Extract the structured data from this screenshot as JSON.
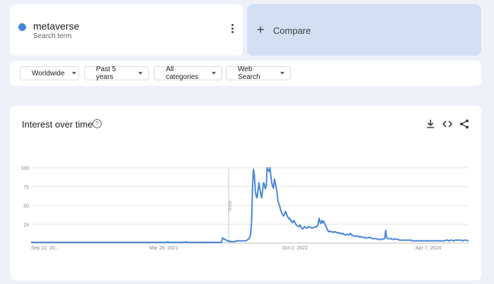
{
  "search_term": {
    "name": "metaverse",
    "subtitle": "Search term",
    "color": "#4a86d8"
  },
  "compare": {
    "label": "Compare"
  },
  "filters": [
    {
      "label": "Worldwide"
    },
    {
      "label": "Past 5 years"
    },
    {
      "label": "All categories"
    },
    {
      "label": "Web Search"
    }
  ],
  "chart_card": {
    "title": "Interest over time",
    "icons": [
      "download-icon",
      "embed-icon",
      "share-icon"
    ]
  },
  "chart_data": {
    "type": "line",
    "title": "Interest over time",
    "xlabel": "",
    "ylabel": "",
    "x_tick_labels": [
      "Sep 22, 20...",
      "Mar 28, 2021",
      "Oct 2, 2022",
      "Apr 7, 2024"
    ],
    "y_ticks": [
      25,
      50,
      75,
      100
    ],
    "ylim": [
      0,
      100
    ],
    "grid": true,
    "annotation": "Note",
    "series": [
      {
        "color": "#4a86d8",
        "values": [
          1,
          1,
          1,
          1,
          1,
          1,
          1,
          1,
          1,
          1,
          1,
          1,
          1,
          1,
          1,
          1,
          1,
          1,
          1,
          1,
          1,
          1,
          1,
          1,
          1,
          1,
          1,
          1,
          1,
          1,
          1,
          1,
          1,
          1,
          1,
          1,
          1,
          1,
          1,
          1,
          1,
          1,
          1,
          1,
          1,
          1,
          1,
          1,
          1,
          1,
          1,
          1,
          1,
          1,
          1,
          1,
          1,
          1,
          1,
          1,
          1,
          1,
          1,
          1,
          1,
          1,
          1,
          1,
          1,
          1,
          1,
          1,
          1,
          1,
          1,
          1,
          1,
          1,
          1,
          1,
          1,
          1,
          1,
          1,
          1,
          1,
          1,
          1,
          1,
          1,
          1,
          1,
          1,
          1,
          1,
          1,
          1,
          1,
          1,
          1,
          1,
          1,
          1,
          1,
          1,
          1,
          1,
          1,
          1,
          1,
          1,
          1,
          1,
          1,
          1,
          1,
          1,
          1,
          1,
          1,
          1,
          1,
          1,
          1,
          1,
          1,
          1,
          1,
          1,
          1,
          1,
          1,
          1,
          1,
          1,
          1,
          1,
          1,
          1,
          1,
          1,
          1,
          1,
          1,
          1,
          1,
          1,
          1,
          1,
          1,
          2,
          1,
          1,
          1,
          1,
          1,
          1,
          1,
          1,
          1,
          1,
          1,
          1,
          1,
          1,
          1,
          1,
          1,
          1,
          1,
          2,
          1,
          1,
          1,
          1,
          1,
          1,
          1,
          1,
          1,
          1,
          1,
          1,
          1,
          1,
          1,
          1,
          1,
          1,
          1,
          1,
          1,
          1,
          1,
          1,
          1,
          1,
          1,
          1,
          1,
          1,
          1,
          1,
          1,
          1,
          1,
          1,
          1,
          1,
          1,
          7,
          6,
          5,
          5,
          4,
          3,
          3,
          2,
          3,
          2,
          2,
          2,
          2,
          2,
          2,
          3,
          3,
          3,
          3,
          3,
          3,
          3,
          3,
          3,
          3,
          3,
          3,
          4,
          5,
          6,
          8,
          13,
          30,
          75,
          98,
          90,
          70,
          62,
          60,
          70,
          80,
          72,
          65,
          60,
          70,
          80,
          78,
          72,
          75,
          100,
          97,
          95,
          100,
          90,
          80,
          75,
          73,
          85,
          80,
          73,
          65,
          55,
          52,
          48,
          43,
          40,
          38,
          36,
          38,
          42,
          40,
          36,
          34,
          32,
          33,
          30,
          28,
          27,
          30,
          29,
          26,
          24,
          23,
          22,
          22,
          24,
          22,
          20,
          19,
          20,
          22,
          21,
          20,
          20,
          22,
          21,
          21,
          21,
          20,
          20,
          21,
          21,
          22,
          21,
          23,
          25,
          33,
          28,
          26,
          30,
          27,
          29,
          26,
          24,
          21,
          18,
          16,
          15,
          16,
          15,
          15,
          15,
          14,
          15,
          15,
          14,
          14,
          13,
          14,
          13,
          13,
          12,
          13,
          12,
          11,
          11,
          11,
          12,
          11,
          11,
          13,
          12,
          10,
          10,
          10,
          9,
          9,
          10,
          9,
          9,
          8,
          9,
          8,
          8,
          8,
          8,
          7,
          7,
          7,
          7,
          7,
          8,
          7,
          7,
          6,
          6,
          6,
          6,
          6,
          6,
          5,
          5,
          5,
          5,
          5,
          5,
          5,
          6,
          6,
          17,
          8,
          6,
          6,
          6,
          6,
          6,
          5,
          5,
          5,
          6,
          5,
          5,
          5,
          5,
          4,
          4,
          4,
          4,
          4,
          4,
          4,
          4,
          4,
          4,
          4,
          4,
          4,
          4,
          3,
          3,
          3,
          3,
          3,
          3,
          3,
          3,
          3,
          3,
          3,
          3,
          3,
          3,
          3,
          3,
          3,
          3,
          3,
          3,
          3,
          3,
          3,
          3,
          3,
          3,
          3,
          3,
          3,
          3,
          3,
          3,
          3,
          3,
          3,
          3,
          3,
          4,
          4,
          4,
          3,
          3,
          4,
          4,
          4,
          3,
          3,
          4,
          4,
          4,
          4,
          4,
          4,
          4,
          4,
          3,
          3,
          4,
          4,
          4,
          4,
          3,
          3
        ]
      }
    ]
  }
}
